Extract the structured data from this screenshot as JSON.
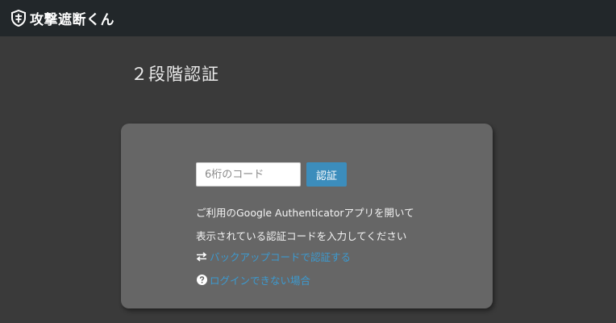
{
  "header": {
    "brand": "攻撃遮断くん"
  },
  "page": {
    "title": "２段階認証"
  },
  "form": {
    "code_placeholder": "6桁のコード",
    "code_value": "",
    "submit_label": "認証"
  },
  "instructions": {
    "line1": "ご利用のGoogle Authenticatorアプリを開いて",
    "line2": "表示されている認証コードを入力してください"
  },
  "links": {
    "backup": {
      "icon": "swap-arrows-icon",
      "label": "バックアップコードで認証する"
    },
    "cant_login": {
      "icon": "question-circle-icon",
      "label": "ログインできない場合"
    }
  },
  "colors": {
    "background": "#3a3a3a",
    "topbar": "#22272a",
    "card": "#666666",
    "accent": "#3c8dbc",
    "link": "#3c9ad0"
  }
}
